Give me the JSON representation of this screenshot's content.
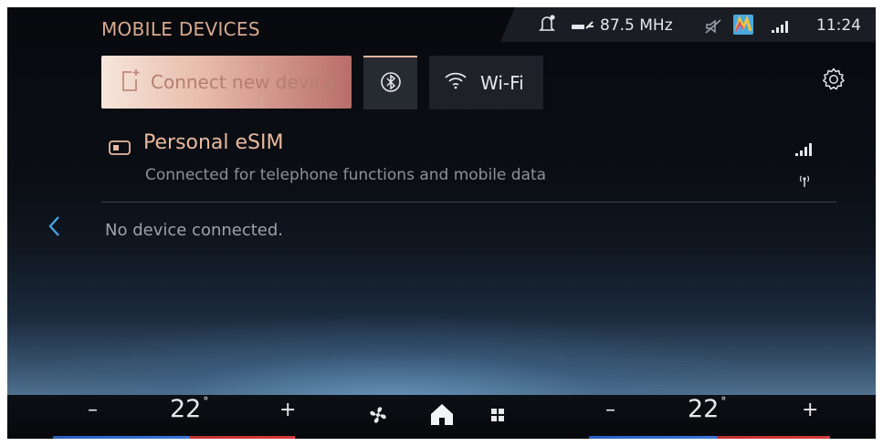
{
  "status": {
    "title": "MOBILE DEVICES",
    "radio": "87.5 MHz",
    "time": "11:24"
  },
  "toolbar": {
    "connect_label": "Connect new device",
    "wifi_label": "Wi-Fi"
  },
  "devices": {
    "esim_name": "Personal eSIM",
    "esim_description": "Connected for telephone functions and mobile data",
    "empty_message": "No device connected."
  },
  "climate": {
    "left_minus": "–",
    "left_temp": "22",
    "left_plus": "+",
    "right_minus": "–",
    "right_temp": "22",
    "right_plus": "+",
    "degree": "°"
  },
  "icons": {
    "status": [
      "notification-bell-icon",
      "radio-icon",
      "mute-icon",
      "app-icon",
      "signal-icon"
    ],
    "toolbar": [
      "phone-add-icon",
      "bluetooth-icon",
      "wifi-icon",
      "settings-gear-icon"
    ],
    "climate": [
      "fan-icon",
      "home-icon",
      "grid-menu-icon"
    ]
  },
  "colors": {
    "accent": "#e8b99f",
    "connect_gradient_start": "#f6e6dc",
    "connect_gradient_end": "#b96d6a",
    "cold_line": "#3a78d8",
    "warm_line": "#d83a3a"
  }
}
